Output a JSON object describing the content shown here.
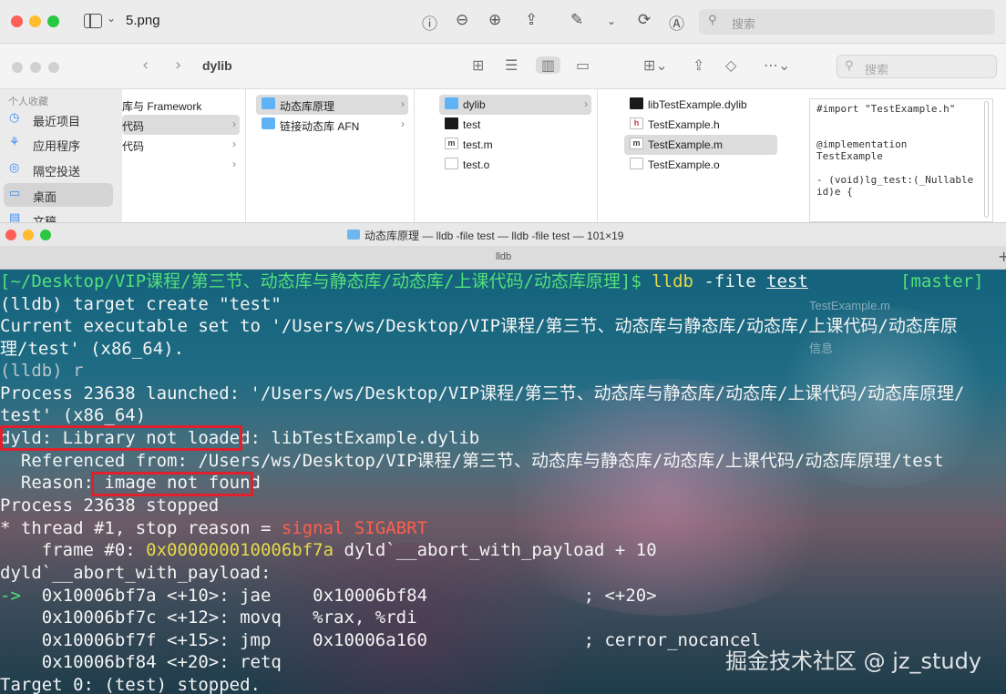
{
  "preview": {
    "title": "5.png",
    "search_placeholder": "搜索"
  },
  "finder": {
    "title": "dylib",
    "search_placeholder": "搜索",
    "sidebar": {
      "section": "个人收藏",
      "items": [
        {
          "label": "最近项目",
          "icon": "clock-icon"
        },
        {
          "label": "应用程序",
          "icon": "apps-icon"
        },
        {
          "label": "隔空投送",
          "icon": "airdrop-icon"
        },
        {
          "label": "桌面",
          "icon": "desktop-icon"
        },
        {
          "label": "文稿",
          "icon": "doc-icon"
        }
      ]
    },
    "col1": [
      "库与 Framework",
      "代码",
      "代码"
    ],
    "col2": [
      "动态库原理",
      "链接动态库 AFN"
    ],
    "col3": [
      "dylib",
      "test",
      "test.m",
      "test.o"
    ],
    "col4": [
      "libTestExample.dylib",
      "TestExample.h",
      "TestExample.m",
      "TestExample.o"
    ],
    "preview_code": "#import \"TestExample.h\"\n\n\n@implementation\nTestExample\n\n- (void)lg_test:(_Nullable\nid)e {"
  },
  "terminal": {
    "window_title": "动态库原理 — lldb -file test — lldb -file test — 101×19",
    "tab_label": "lldb",
    "lines": {
      "prompt": "[~/Desktop/VIP课程/第三节、动态库与静态库/动态库/上课代码/动态库原理]$",
      "cmd_lldb": "lldb",
      "cmd_rest": " -file ",
      "cmd_test": "test",
      "branch": "[master]",
      "l2": "(lldb) target create \"test\"",
      "l3": "Current executable set to '/Users/ws/Desktop/VIP课程/第三节、动态库与静态库/动态库/上课代码/动态库原",
      "l4": "理/test' (x86_64).",
      "l5": "(lldb) r",
      "l6": "Process 23638 launched: '/Users/ws/Desktop/VIP课程/第三节、动态库与静态库/动态库/上课代码/动态库原理/",
      "l7": "test' (x86_64)",
      "l8a": "dyld: Library not loaded",
      "l8b": ": libTestExample.dylib",
      "l9": "  Referenced from: /Users/ws/Desktop/VIP课程/第三节、动态库与静态库/动态库/上课代码/动态库原理/test",
      "l10a": "  Reason: ",
      "l10b": "image not found",
      "l11": "Process 23638 stopped",
      "l12a": "* thread #1, stop reason = ",
      "l12b": "signal SIGABRT",
      "l13a": "    frame #0: ",
      "l13b": "0x000000010006bf7a",
      "l13c": " dyld`__abort_with_payload + 10",
      "l14": "dyld`__abort_with_payload:",
      "l15a": "->",
      "l15b": "  0x10006bf7a <+10>: jae    0x10006bf84               ; <+20>",
      "l16": "    0x10006bf7c <+12>: movq   %rax, %rdi",
      "l17": "    0x10006bf7f <+15>: jmp    0x10006a160               ; cerror_nocancel",
      "l18": "    0x10006bf84 <+20>: retq",
      "l19": "Target 0: (test) stopped."
    },
    "ghost_text": [
      "TestExample.m",
      "信息"
    ],
    "watermark": "掘金技术社区 @ jz_study"
  }
}
